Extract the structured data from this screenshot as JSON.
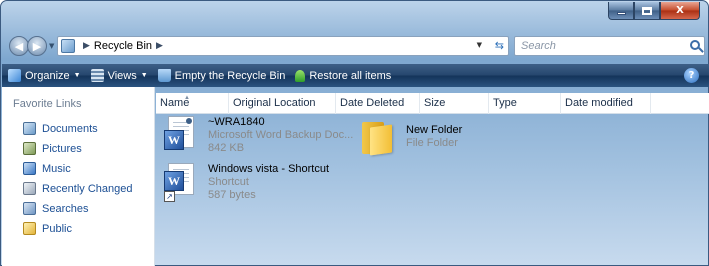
{
  "window": {
    "controls": {
      "minimize": "–",
      "maximize": "□",
      "close": "X"
    }
  },
  "address_bar": {
    "segment": "Recycle Bin",
    "search_placeholder": "Search"
  },
  "toolbar": {
    "organize": "Organize",
    "views": "Views",
    "empty_bin": "Empty the Recycle Bin",
    "restore_all": "Restore all items",
    "help": "?"
  },
  "sidebar": {
    "heading": "Favorite Links",
    "items": [
      {
        "label": "Documents",
        "icon": "documents-icon"
      },
      {
        "label": "Pictures",
        "icon": "pictures-icon"
      },
      {
        "label": "Music",
        "icon": "music-icon"
      },
      {
        "label": "Recently Changed",
        "icon": "recently-changed-icon"
      },
      {
        "label": "Searches",
        "icon": "searches-icon"
      },
      {
        "label": "Public",
        "icon": "public-folder-icon"
      }
    ]
  },
  "columns": [
    "Name",
    "Original Location",
    "Date Deleted",
    "Size",
    "Type",
    "Date modified"
  ],
  "files": [
    {
      "name": "~WRA1840",
      "line2": "Microsoft Word Backup Doc...",
      "line3": "842 KB"
    },
    {
      "name": "New Folder",
      "line2": "File Folder"
    },
    {
      "name": "Windows vista - Shortcut",
      "line2": "Shortcut",
      "line3": "587 bytes"
    }
  ]
}
